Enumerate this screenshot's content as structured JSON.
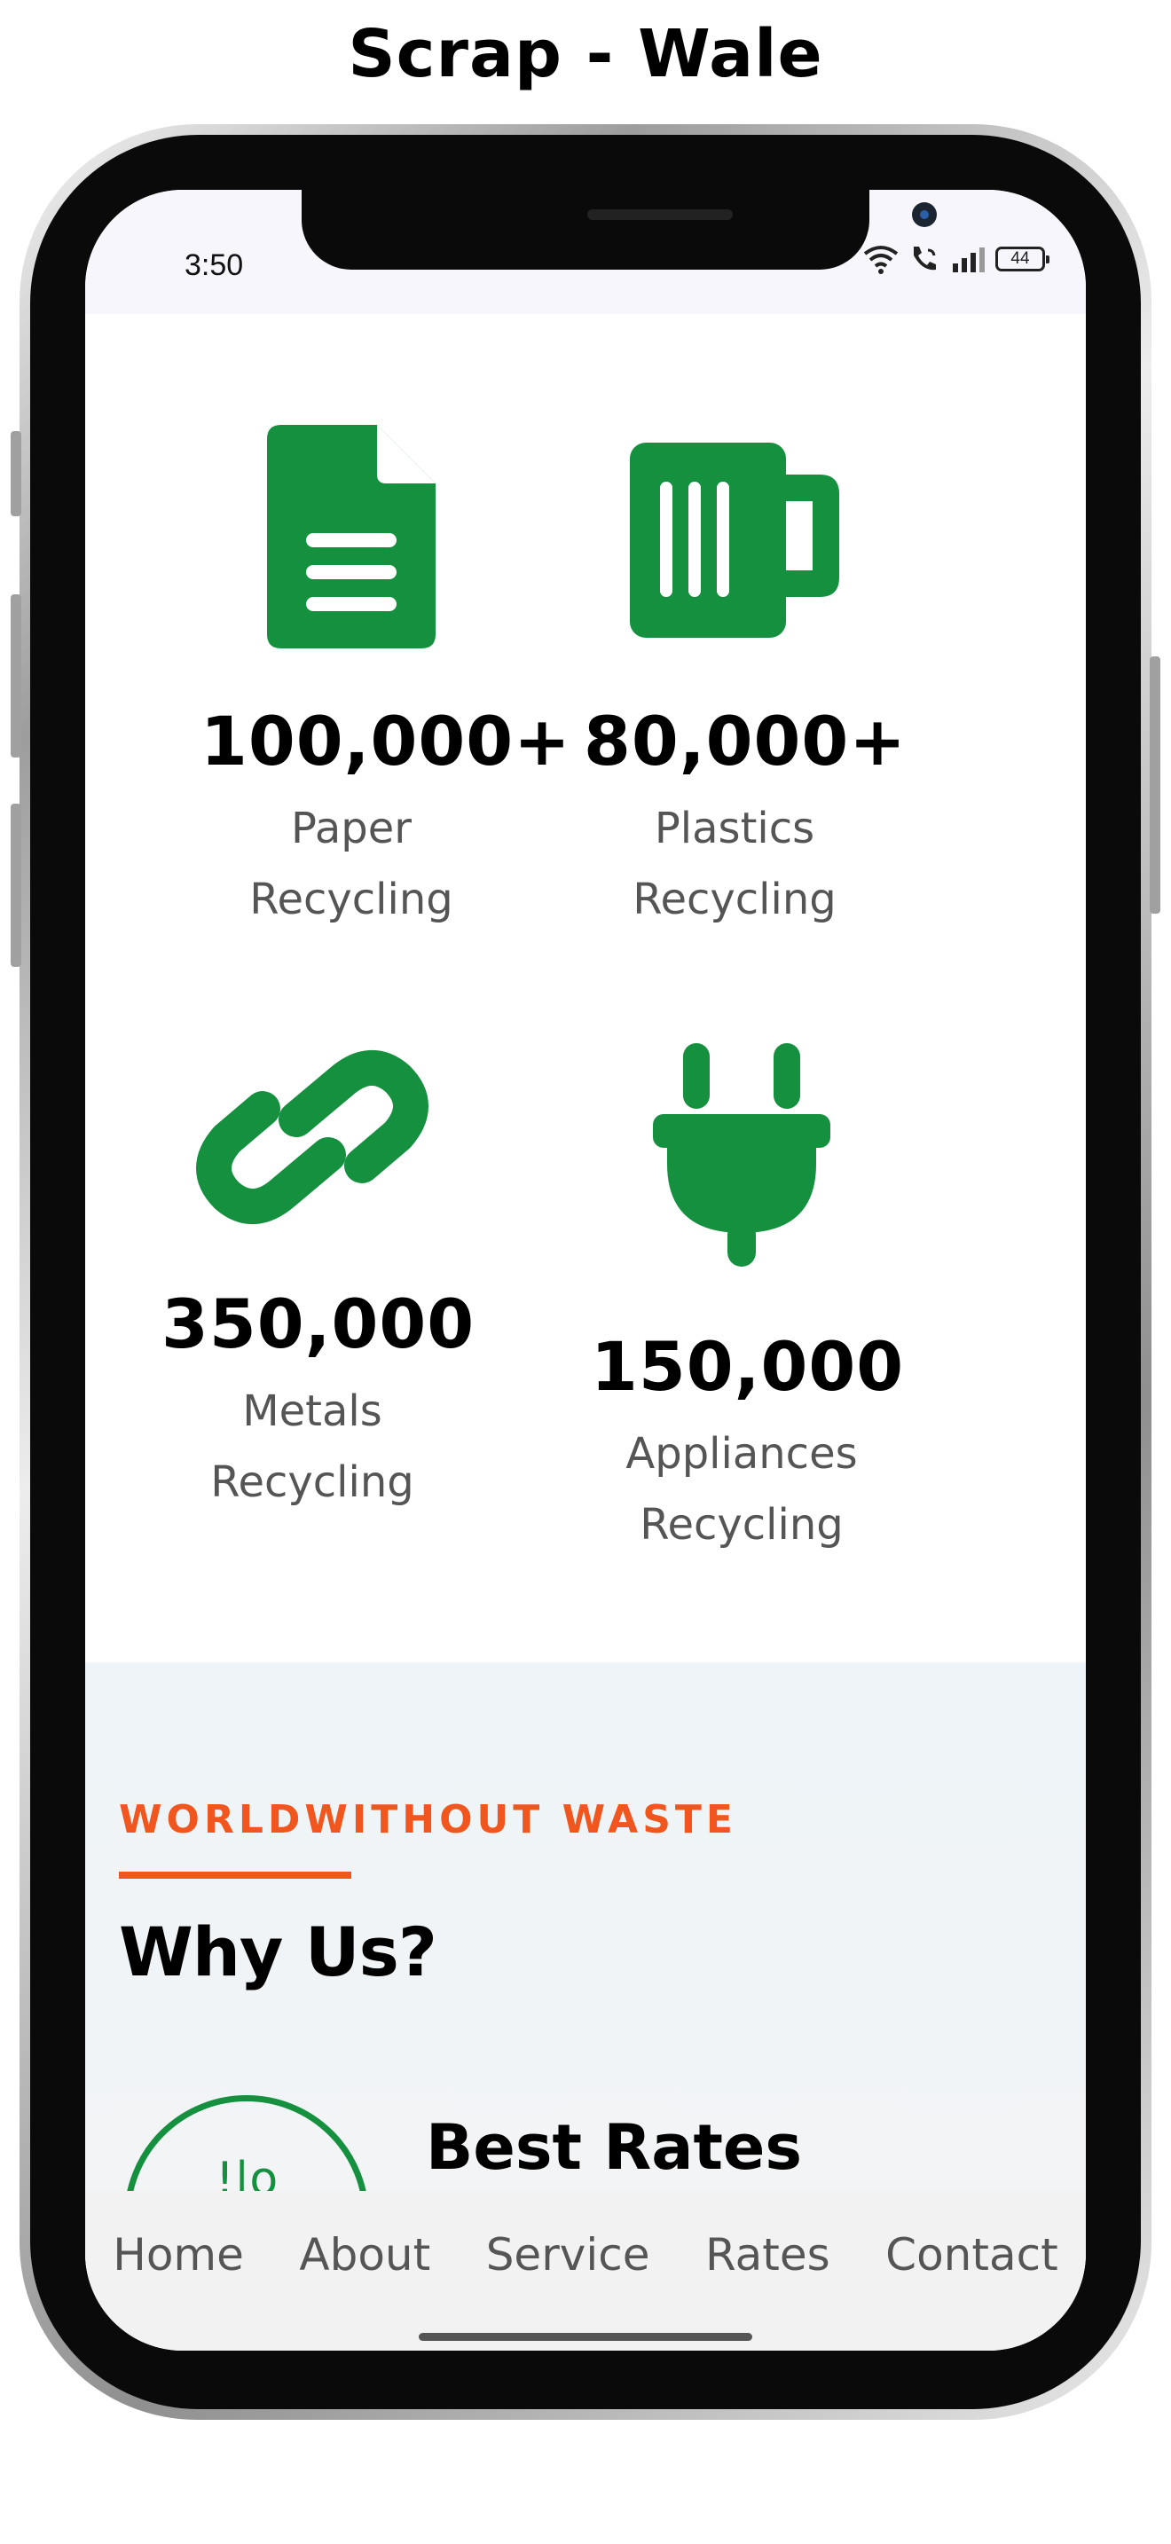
{
  "page_title": "Scrap - Wale",
  "status_bar": {
    "time": "3:50",
    "battery": "44",
    "icons": [
      "wifi-icon",
      "wifi-calling-icon",
      "signal-icon",
      "battery-icon"
    ]
  },
  "stats": [
    {
      "icon": "document-icon",
      "value": "100,000+",
      "label": "Paper\nRecycling"
    },
    {
      "icon": "mug-icon",
      "value": "80,000+",
      "label": "Plastics\nRecycling"
    },
    {
      "icon": "link-icon",
      "value": "350,000",
      "label": "Metals\nRecycling"
    },
    {
      "icon": "plug-icon",
      "value": "150,000",
      "label": "Appliances\nRecycling"
    }
  ],
  "why_us": {
    "eyebrow": "WORLDWITHOUT WASTE",
    "title": "Why Us?",
    "feature_title": "Best Rates",
    "feature_glyph": "!|o"
  },
  "scroll_progress": 0.25,
  "nav": {
    "items": [
      "Home",
      "About",
      "Service",
      "Rates",
      "Contact"
    ]
  },
  "colors": {
    "brand_green": "#15903f",
    "accent_orange": "#f0561d",
    "nav_background": "#f2f2f2"
  }
}
